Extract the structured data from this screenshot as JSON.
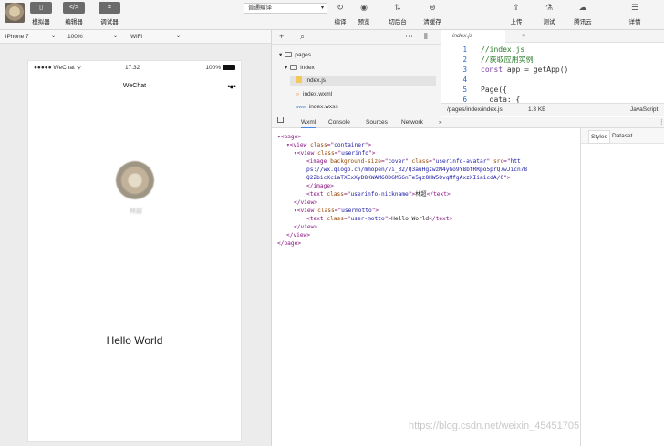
{
  "toolbar": {
    "left_buttons": [
      {
        "label": "模拟器",
        "icon": "phone-icon",
        "glyph": "▯"
      },
      {
        "label": "编辑器",
        "icon": "code-icon",
        "glyph": "</>"
      },
      {
        "label": "调试器",
        "icon": "debug-icon",
        "glyph": "⌗"
      }
    ],
    "compile_mode": "普通编译",
    "mid_buttons": [
      {
        "label": "编译",
        "icon": "refresh-icon",
        "glyph": "↻"
      },
      {
        "label": "预览",
        "icon": "eye-icon",
        "glyph": "◉"
      },
      {
        "label": "切后台",
        "icon": "switch-icon",
        "glyph": "⇅"
      },
      {
        "label": "清缓存",
        "icon": "layers-icon",
        "glyph": "⊜"
      }
    ],
    "right_buttons": [
      {
        "label": "上传",
        "icon": "upload-icon",
        "glyph": "⇪"
      },
      {
        "label": "测试",
        "icon": "test-icon",
        "glyph": "⚗"
      },
      {
        "label": "腾讯云",
        "icon": "cloud-icon",
        "glyph": "☁"
      },
      {
        "label": "详情",
        "icon": "menu-icon",
        "glyph": "☰"
      }
    ]
  },
  "devicebar": {
    "device": "iPhone 7",
    "zoom": "100%",
    "network": "WiFi"
  },
  "simulator": {
    "carrier": "●●●●● WeChat ᯤ",
    "time": "17:32",
    "battery": "100%",
    "nav_title": "WeChat",
    "nav_dots": "•●•",
    "nickname": "林超",
    "motto": "Hello World"
  },
  "filetree": {
    "rows": [
      {
        "name": "pages",
        "type": "folder",
        "arrow": "▾"
      },
      {
        "name": "index",
        "type": "folder",
        "arrow": "▾"
      },
      {
        "name": "index.js",
        "type": "js",
        "selected": true
      },
      {
        "name": "index.wxml",
        "type": "wxml"
      },
      {
        "name": "index.wxss",
        "type": "wxss"
      }
    ]
  },
  "editor": {
    "tab": "index.js",
    "lines": [
      {
        "n": "1",
        "text": "//index.js",
        "cls": "comment"
      },
      {
        "n": "2",
        "text": "//获取应用实例",
        "cls": "comment"
      },
      {
        "n": "3",
        "text": "const app = getApp()",
        "cls": "code"
      },
      {
        "n": "4",
        "text": "",
        "cls": "code"
      },
      {
        "n": "5",
        "text": "Page({",
        "cls": "code"
      },
      {
        "n": "6",
        "text": "  data: {",
        "cls": "code"
      }
    ],
    "path": "/pages/index/index.js",
    "size": "1.3 KB",
    "lang": "JavaScript"
  },
  "devtools": {
    "tabs": [
      "Wxml",
      "Console",
      "Sources",
      "Network",
      "»"
    ],
    "side_tabs": [
      "Styles",
      "Dataset"
    ],
    "wxml_lines": [
      {
        "indent": 0,
        "html": "▾&lt;page&gt;"
      },
      {
        "indent": 1,
        "html": "▾&lt;view <a>class</a>=\"<v>container</v>\"&gt;"
      },
      {
        "indent": 2,
        "html": "▾&lt;view <a>class</a>=\"<v>userinfo</v>\"&gt;"
      },
      {
        "indent": 3,
        "html": "&lt;image <a>background-size</a>=\"<v>cover</v>\" <a>class</a>=\"<v>userinfo-avatar</v>\" <a>src</a>=\"<v>htt</v>"
      },
      {
        "indent": 3,
        "html": "<v>ps://wx.qlogo.cn/mmopen/vi_32/Q3auHgzwzM4yGo9Y8bfRRpo5prQ7wJicn78</v>"
      },
      {
        "indent": 3,
        "html": "<v>Q2ZbicKciaTXExXyD8KWAM60DGM66nTe5gz8HW5QvqMfgAxzXIiaicdA/0</v>\"&gt;"
      },
      {
        "indent": 3,
        "html": "&lt;/image&gt;"
      },
      {
        "indent": 3,
        "html": "&lt;text <a>class</a>=\"<v>userinfo-nickname</v>\"&gt;<t>林超</t>&lt;/text&gt;"
      },
      {
        "indent": 2,
        "html": "&lt;/view&gt;"
      },
      {
        "indent": 2,
        "html": "▾&lt;view <a>class</a>=\"<v>usermotto</v>\"&gt;"
      },
      {
        "indent": 3,
        "html": "&lt;text <a>class</a>=\"<v>user-motto</v>\"&gt;<t>Hello World</t>&lt;/text&gt;"
      },
      {
        "indent": 2,
        "html": "&lt;/view&gt;"
      },
      {
        "indent": 1,
        "html": "&lt;/view&gt;"
      },
      {
        "indent": 0,
        "html": "&lt;/page&gt;"
      }
    ]
  },
  "watermark": "https://blog.csdn.net/weixin_45451705"
}
